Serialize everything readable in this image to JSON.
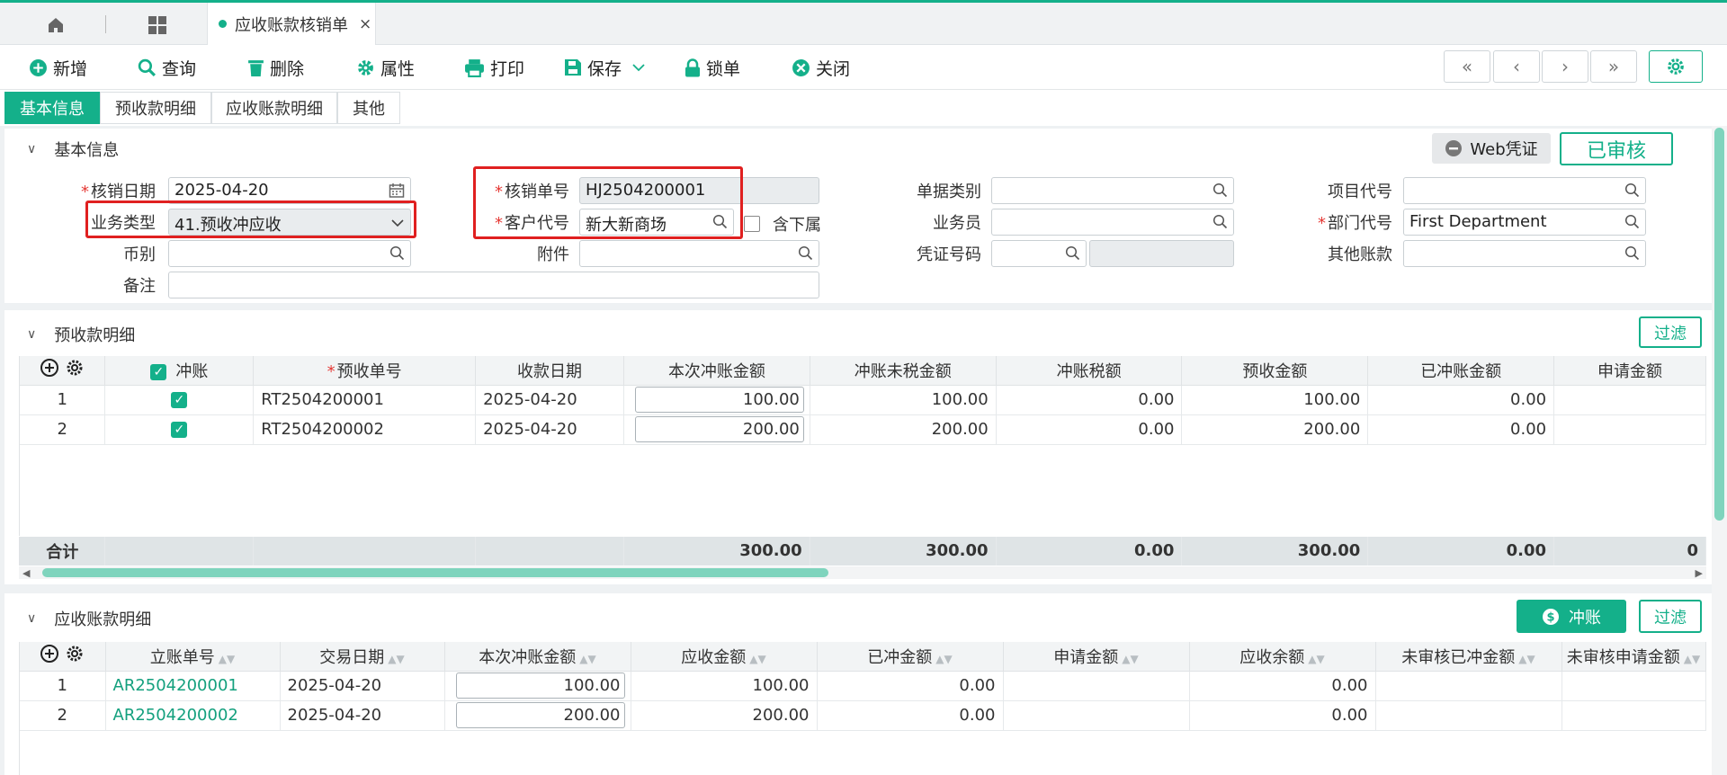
{
  "tabbar": {
    "active_tab": "应收账款核销单",
    "close": "×"
  },
  "toolbar": {
    "new": "新增",
    "query": "查询",
    "delete": "删除",
    "props": "属性",
    "print": "打印",
    "save": "保存",
    "lock": "锁单",
    "close": "关闭"
  },
  "nav": {
    "first": "«",
    "prev": "‹",
    "next": "›",
    "last": "»"
  },
  "section_tabs": [
    "基本信息",
    "预收款明细",
    "应收账款明细",
    "其他"
  ],
  "basic": {
    "title": "基本信息",
    "web_voucher": "Web凭证",
    "status": "已审核",
    "fields": {
      "date_label": "核销日期",
      "date_value": "2025-04-20",
      "biz_label": "业务类型",
      "biz_value": "41.预收冲应收",
      "currency_label": "币别",
      "remark_label": "备注",
      "no_label": "核销单号",
      "no_value": "HJ2504200001",
      "customer_label": "客户代号",
      "customer_value": "新大新商场",
      "include_sub": "含下属",
      "attach_label": "附件",
      "doctype_label": "单据类别",
      "salesman_label": "业务员",
      "voucher_label": "凭证号码",
      "project_label": "项目代号",
      "dept_label": "部门代号",
      "dept_value": "First Department",
      "other_label": "其他账款"
    }
  },
  "prepay": {
    "title": "预收款明细",
    "filter": "过滤",
    "headers": [
      "冲账",
      "预收单号",
      "收款日期",
      "本次冲账金额",
      "冲账未税金额",
      "冲账税额",
      "预收金额",
      "已冲账金额",
      "申请金额"
    ],
    "rows": [
      {
        "idx": "1",
        "no": "RT2504200001",
        "date": "2025-04-20",
        "amt": "100.00",
        "untaxed": "100.00",
        "tax": "0.00",
        "prepay": "100.00",
        "done": "0.00"
      },
      {
        "idx": "2",
        "no": "RT2504200002",
        "date": "2025-04-20",
        "amt": "200.00",
        "untaxed": "200.00",
        "tax": "0.00",
        "prepay": "200.00",
        "done": "0.00"
      }
    ],
    "total": {
      "label": "合计",
      "amt": "300.00",
      "untaxed": "300.00",
      "tax": "0.00",
      "prepay": "300.00",
      "done": "0.00",
      "apply": "0"
    }
  },
  "ar": {
    "title": "应收账款明细",
    "offset": "冲账",
    "filter": "过滤",
    "headers": [
      "立账单号",
      "交易日期",
      "本次冲账金额",
      "应收金额",
      "已冲金额",
      "申请金额",
      "应收余额",
      "未审核已冲金额",
      "未审核申请金额"
    ],
    "rows": [
      {
        "idx": "1",
        "no": "AR2504200001",
        "date": "2025-04-20",
        "amt": "100.00",
        "recv": "100.00",
        "done": "0.00",
        "balance": "0.00"
      },
      {
        "idx": "2",
        "no": "AR2504200002",
        "date": "2025-04-20",
        "amt": "200.00",
        "recv": "200.00",
        "done": "0.00",
        "balance": "0.00"
      }
    ]
  },
  "colors": {
    "accent": "#14b08a",
    "highlight": "#e02020"
  }
}
